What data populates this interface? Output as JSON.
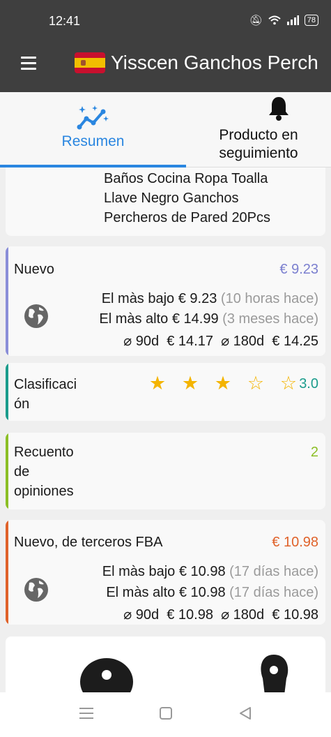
{
  "status_bar": {
    "time": "12:41",
    "battery": "78"
  },
  "app_bar": {
    "title": "Yisscen Ganchos Perch"
  },
  "tabs": [
    {
      "label": "Resumen"
    },
    {
      "label_line1": "Producto en",
      "label_line2": "seguimiento"
    }
  ],
  "title_card": {
    "line1": "Baños Cocina Ropa Toalla",
    "line2": "Llave Negro Ganchos",
    "line3": "Percheros de Pared 20Pcs"
  },
  "new_price_card": {
    "label": "Nuevo",
    "price": "€ 9.23",
    "lowest_label": "El màs bajo",
    "lowest_value": "€ 9.23",
    "lowest_when": "(10 horas hace)",
    "highest_label": "El màs alto",
    "highest_value": "€ 14.99",
    "highest_when": "(3 meses hace)",
    "avg": "⌀ 90d  € 14.17  ⌀ 180d  € 14.25"
  },
  "rating_card": {
    "label_line1": "Clasificaci",
    "label_line2": "ón",
    "value": "3.0",
    "rating": 3,
    "max": 5
  },
  "reviews_card": {
    "label_line1": "Recuento",
    "label_line2": "de",
    "label_line3": "opiniones",
    "value": "2"
  },
  "fba_card": {
    "label": "Nuevo, de terceros FBA",
    "price": "€ 10.98",
    "lowest_label": "El màs bajo",
    "lowest_value": "€ 10.98",
    "lowest_when": "(17 días hace)",
    "highest_label": "El màs alto",
    "highest_value": "€ 10.98",
    "highest_when": "(17 días hace)",
    "avg": "⌀ 90d  € 10.98  ⌀ 180d  € 10.98"
  },
  "colors": {
    "accent_blue": "#2a86e0",
    "new_stripe": "#8a8ed8",
    "new_price": "#7b7fcf",
    "rating_stripe": "#1b9c8c",
    "rating_value": "#1b9c8c",
    "reviews_stripe": "#8cbf26",
    "reviews_value": "#8cbf26",
    "fba_stripe": "#e0622a",
    "fba_price": "#e0622a"
  },
  "icons": [
    "menu-icon",
    "spain-flag-icon",
    "sparkle-chart-icon",
    "bell-icon",
    "globe-icon",
    "star-icon",
    "nav-menu-icon",
    "nav-home-icon",
    "nav-back-icon"
  ]
}
